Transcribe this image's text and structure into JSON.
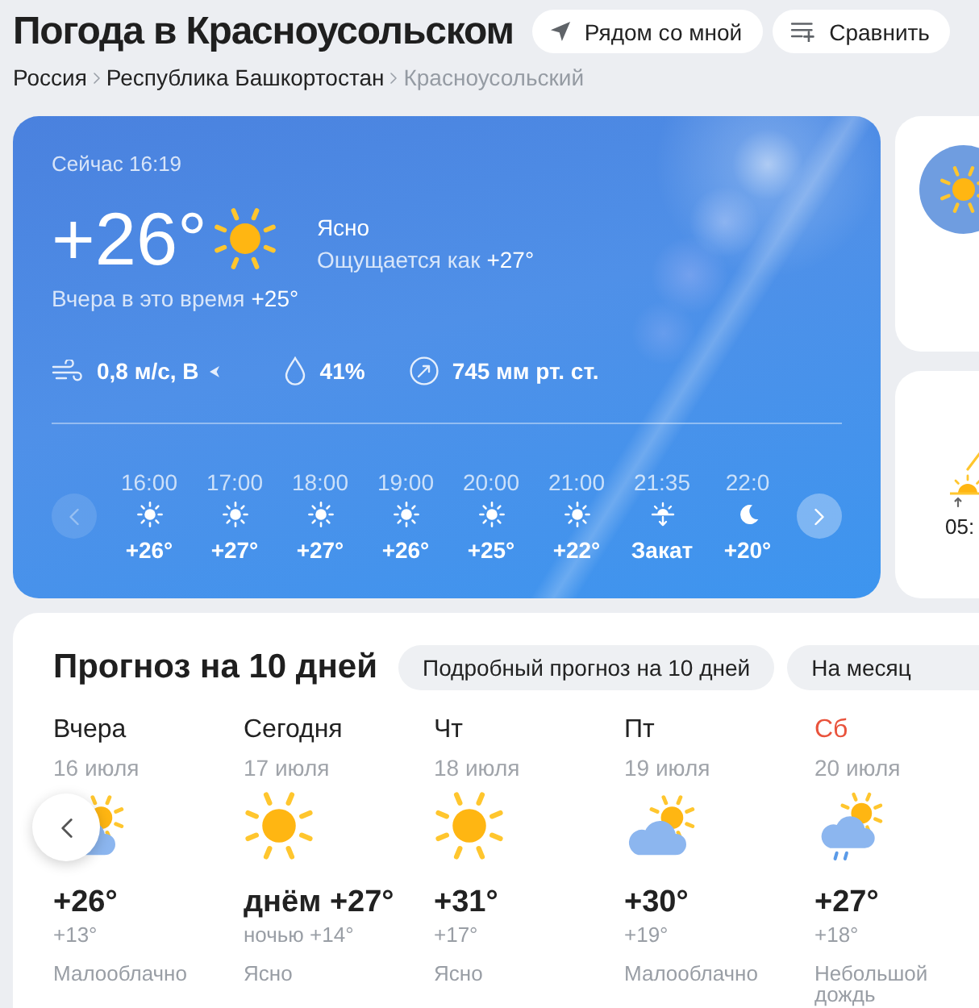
{
  "header": {
    "title": "Погода в Красноусольском",
    "buttons": [
      {
        "label": "Рядом со мной",
        "kind": "nearby"
      },
      {
        "label": "Сравнить",
        "kind": "compare"
      }
    ]
  },
  "breadcrumbs": [
    {
      "label": "Россия",
      "current": false
    },
    {
      "label": "Республика Башкортостан",
      "current": false
    },
    {
      "label": "Красноусольский",
      "current": true
    }
  ],
  "current": {
    "time_label": "Сейчас 16:19",
    "temperature": "+26°",
    "condition": "Ясно",
    "feels_like": {
      "label": "Ощущается как",
      "value": "+27°"
    },
    "yesterday": {
      "label": "Вчера в это время",
      "value": "+25°"
    },
    "wind": "0,8 м/с, В",
    "humidity": "41%",
    "pressure": "745 мм рт. ст."
  },
  "hourly": {
    "prev_button": {
      "disabled": true
    },
    "next_button": {
      "disabled": false
    },
    "items": [
      {
        "time": "16:00",
        "kind": "day",
        "value": "+26°"
      },
      {
        "time": "17:00",
        "kind": "day",
        "value": "+27°"
      },
      {
        "time": "18:00",
        "kind": "day",
        "value": "+27°"
      },
      {
        "time": "19:00",
        "kind": "day",
        "value": "+26°"
      },
      {
        "time": "20:00",
        "kind": "day",
        "value": "+25°"
      },
      {
        "time": "21:00",
        "kind": "day",
        "value": "+22°"
      },
      {
        "time": "21:35",
        "kind": "sunset",
        "value": "Закат"
      },
      {
        "time": "22:0",
        "kind": "night",
        "value": "+20°"
      }
    ]
  },
  "side_panel": {
    "sunrise_time": "05:"
  },
  "forecast": {
    "title": "Прогноз на 10 дней",
    "buttons": [
      {
        "label": "Подробный прогноз на 10 дней"
      },
      {
        "label": "На месяц"
      }
    ],
    "days": [
      {
        "name": "Вчера",
        "date": "16 июля",
        "kind": "cloudy",
        "day_temp": "+26°",
        "night_temp": "+13°",
        "condition": "Малооблачно",
        "weekend": false
      },
      {
        "name": "Сегодня",
        "date": "17 июля",
        "kind": "clear",
        "day_temp": "днём +27°",
        "night_temp": "ночью +14°",
        "condition": "Ясно",
        "weekend": false
      },
      {
        "name": "Чт",
        "date": "18 июля",
        "kind": "clear",
        "day_temp": "+31°",
        "night_temp": "+17°",
        "condition": "Ясно",
        "weekend": false
      },
      {
        "name": "Пт",
        "date": "19 июля",
        "kind": "cloudy",
        "day_temp": "+30°",
        "night_temp": "+19°",
        "condition": "Малооблачно",
        "weekend": false
      },
      {
        "name": "Сб",
        "date": "20 июля",
        "kind": "rain",
        "day_temp": "+27°",
        "night_temp": "+18°",
        "condition": "Небольшой дождь",
        "weekend": true
      }
    ]
  }
}
